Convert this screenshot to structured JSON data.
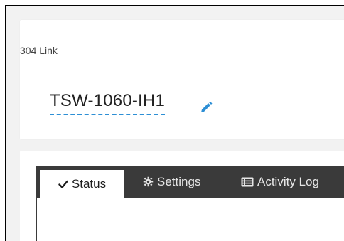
{
  "header": {
    "breadcrumb": "304 Link",
    "device_name": "TSW-1060-IH1"
  },
  "icons": {
    "edit": "pencil-icon",
    "status": "check-icon",
    "settings": "gear-icon",
    "activity": "list-icon"
  },
  "tabs": [
    {
      "label": "Status",
      "active": true
    },
    {
      "label": "Settings",
      "active": false
    },
    {
      "label": "Activity Log",
      "active": false
    }
  ],
  "colors": {
    "accent": "#2d8fd5",
    "tab_strip": "#3a3a3a",
    "background": "#f2f2f2"
  }
}
